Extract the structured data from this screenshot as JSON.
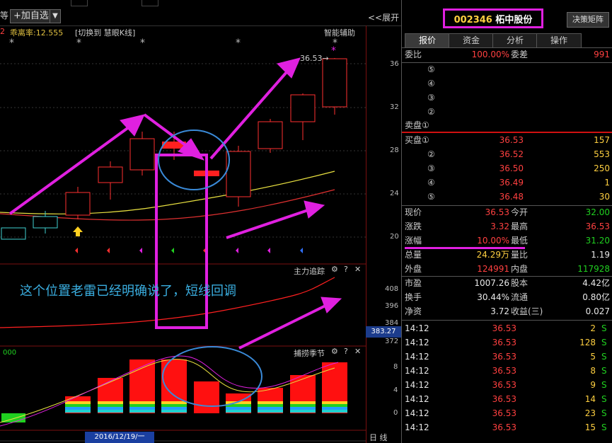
{
  "toolbar": {
    "truncated_left": "等",
    "add_watchlist_label": "+加自选",
    "expand_label": "<<展开"
  },
  "chart_header": {
    "prefix": "2",
    "ma_label": "乖离率:12.555",
    "switch_label": "[切换到 慧眼K线]",
    "assist_label": "智能辅助",
    "max_price_label": "36.53"
  },
  "price_axis": [
    "36",
    "32",
    "28",
    "24",
    "20"
  ],
  "panel2": {
    "title": "主力追踪",
    "ticks": [
      "408",
      "396",
      "384",
      "372"
    ],
    "current_badge": "383.27"
  },
  "panel3": {
    "title": "捕捞季节",
    "left_value": "000",
    "ticks": [
      "8",
      "4",
      "0"
    ]
  },
  "annotation_text": "这个位置老雷已经明确说了，短线回调",
  "date_badge": "2016/12/19/一",
  "period_label": "日 线",
  "stock": {
    "code": "002346",
    "name": "柘中股份",
    "decision_label": "决策矩阵"
  },
  "tabs": [
    "报价",
    "资金",
    "分析",
    "操作"
  ],
  "order_book": {
    "weibi_label": "委比",
    "weibi_value": "100.00%",
    "weicha_label": "委差",
    "weicha_value": "991",
    "sell_levels": [
      "⑤",
      "④",
      "③",
      "②"
    ],
    "sell_title": "卖盘①",
    "buy": [
      {
        "label": "买盘①",
        "price": "36.53",
        "vol": "157"
      },
      {
        "label": "②",
        "price": "36.52",
        "vol": "553"
      },
      {
        "label": "③",
        "price": "36.50",
        "vol": "250"
      },
      {
        "label": "④",
        "price": "36.49",
        "vol": "1"
      },
      {
        "label": "⑤",
        "price": "36.48",
        "vol": "30"
      }
    ]
  },
  "stats": [
    {
      "l1": "现价",
      "v1": "36.53",
      "c1": "red",
      "l2": "今开",
      "v2": "32.00",
      "c2": "green"
    },
    {
      "l1": "涨跌",
      "v1": "3.32",
      "c1": "red",
      "l2": "最高",
      "v2": "36.53",
      "c2": "red"
    },
    {
      "l1": "涨幅",
      "v1": "10.00%",
      "c1": "red",
      "l2": "最低",
      "v2": "31.20",
      "c2": "green"
    },
    {
      "l1": "总量",
      "v1": "24.29万",
      "c1": "yellow",
      "l2": "量比",
      "v2": "1.19",
      "c2": "white"
    },
    {
      "l1": "外盘",
      "v1": "124991",
      "c1": "red",
      "l2": "内盘",
      "v2": "117928",
      "c2": "green"
    }
  ],
  "fundamentals": [
    {
      "l1": "市盈",
      "v1": "1007.26",
      "l2": "股本",
      "v2": "4.42亿"
    },
    {
      "l1": "换手",
      "v1": "30.44%",
      "l2": "流通",
      "v2": "0.80亿"
    },
    {
      "l1": "净资",
      "v1": "3.72",
      "l2": "收益(三)",
      "v2": "0.027"
    }
  ],
  "ticks_list": [
    {
      "time": "14:12",
      "price": "36.53",
      "vol": "2",
      "side": "S"
    },
    {
      "time": "14:12",
      "price": "36.53",
      "vol": "128",
      "side": "S"
    },
    {
      "time": "14:12",
      "price": "36.53",
      "vol": "5",
      "side": "S"
    },
    {
      "time": "14:12",
      "price": "36.53",
      "vol": "8",
      "side": "S"
    },
    {
      "time": "14:12",
      "price": "36.53",
      "vol": "9",
      "side": "S"
    },
    {
      "time": "14:12",
      "price": "36.53",
      "vol": "14",
      "side": "S"
    },
    {
      "time": "14:12",
      "price": "36.53",
      "vol": "23",
      "side": "S"
    },
    {
      "time": "14:12",
      "price": "36.53",
      "vol": "15",
      "side": "S"
    }
  ],
  "colors": {
    "up": "#ff4040",
    "down": "#20d020",
    "highlight": "#e020e0",
    "annotation": "#3aaee0"
  }
}
